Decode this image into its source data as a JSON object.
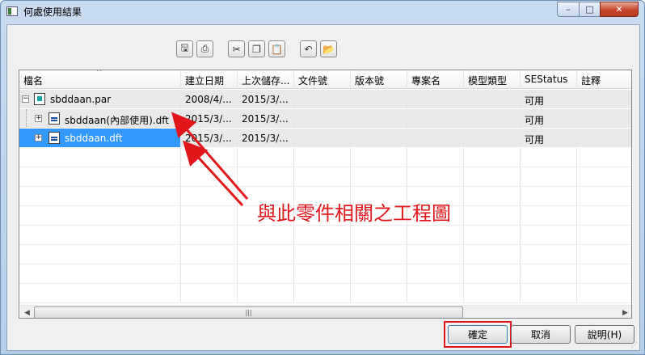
{
  "window": {
    "title": "何處使用結果",
    "minimize_glyph": "–",
    "maximize_glyph": "□",
    "close_glyph": "✕"
  },
  "toolbar": {
    "buttons": [
      {
        "name": "save-icon",
        "glyph": "🖫"
      },
      {
        "name": "print-icon",
        "glyph": "⎙"
      },
      {
        "name": "cut-icon",
        "glyph": "✂"
      },
      {
        "name": "copy-icon",
        "glyph": "❐"
      },
      {
        "name": "paste-icon",
        "glyph": "📋"
      },
      {
        "name": "undo-icon",
        "glyph": "↶"
      },
      {
        "name": "open-folder-icon",
        "glyph": "📂"
      }
    ]
  },
  "grid": {
    "columns": [
      "檔名",
      "建立日期",
      "上次儲存...",
      "文件號",
      "版本號",
      "專案名",
      "模型類型",
      "SEStatus",
      "註釋"
    ],
    "rows": [
      {
        "name": "sbddaan.par",
        "type": "par",
        "level": 0,
        "expander": "−",
        "created": "2008/4/...",
        "saved": "2015/3/...",
        "doc_no": "",
        "rev": "",
        "project": "",
        "model_type": "",
        "status": "可用",
        "comment": ""
      },
      {
        "name": "sbddaan(內部使用).dft",
        "type": "dft",
        "level": 1,
        "expander": "+",
        "created": "2015/3/...",
        "saved": "2015/3/...",
        "doc_no": "",
        "rev": "",
        "project": "",
        "model_type": "",
        "status": "可用",
        "comment": ""
      },
      {
        "name": "sbddaan.dft",
        "type": "dft",
        "level": 1,
        "expander": "+",
        "created": "2015/3/...",
        "saved": "2015/3/...",
        "doc_no": "",
        "rev": "",
        "project": "",
        "model_type": "",
        "status": "可用",
        "comment": "",
        "selected": true
      }
    ]
  },
  "annotation": {
    "text": "與此零件相關之工程圖",
    "color": "#e0161b"
  },
  "buttons": {
    "ok": "確定",
    "cancel": "取消",
    "help": "說明(H)"
  },
  "colors": {
    "selection": "#3399ff",
    "highlight": "#e1161b"
  }
}
